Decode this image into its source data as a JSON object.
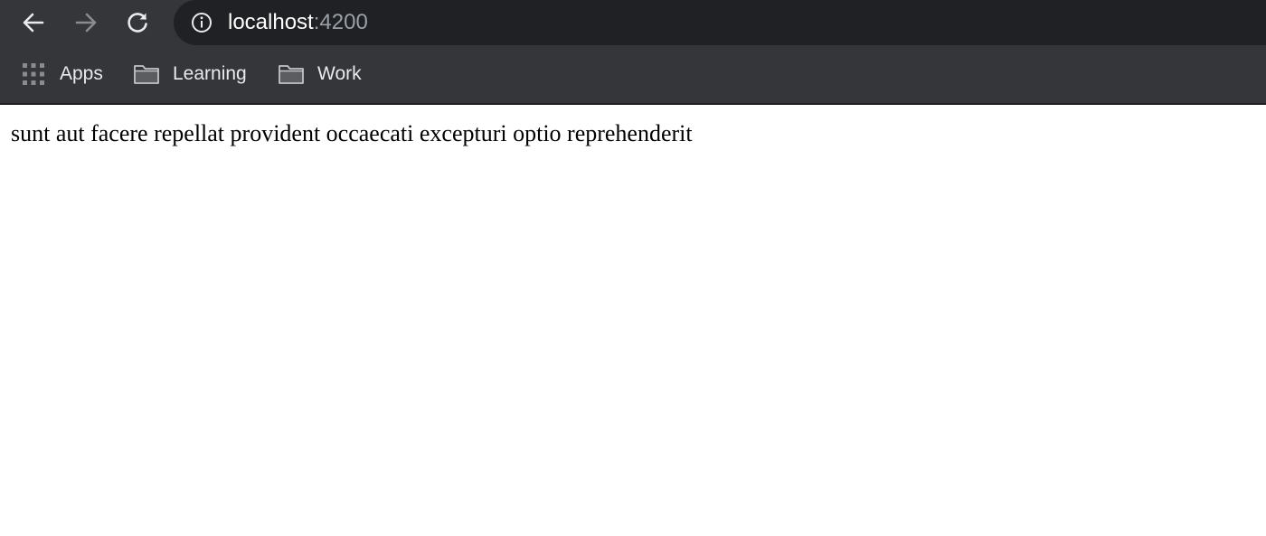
{
  "browser": {
    "nav": {
      "back_icon": "arrow-left-icon",
      "forward_icon": "arrow-right-icon",
      "reload_icon": "reload-icon"
    },
    "address_bar": {
      "icon": "info-icon",
      "host": "localhost",
      "port": ":4200"
    },
    "bookmarks": [
      {
        "label": "Apps",
        "icon": "apps-grid-icon"
      },
      {
        "label": "Learning",
        "icon": "folder-icon"
      },
      {
        "label": "Work",
        "icon": "folder-icon"
      }
    ],
    "colors": {
      "toolbar": "#35363a",
      "omnibox": "#202124",
      "text": "#e8eaed",
      "muted": "#9aa0a6"
    }
  },
  "page": {
    "title": "sunt aut facere repellat provident occaecati excepturi optio reprehenderit"
  }
}
